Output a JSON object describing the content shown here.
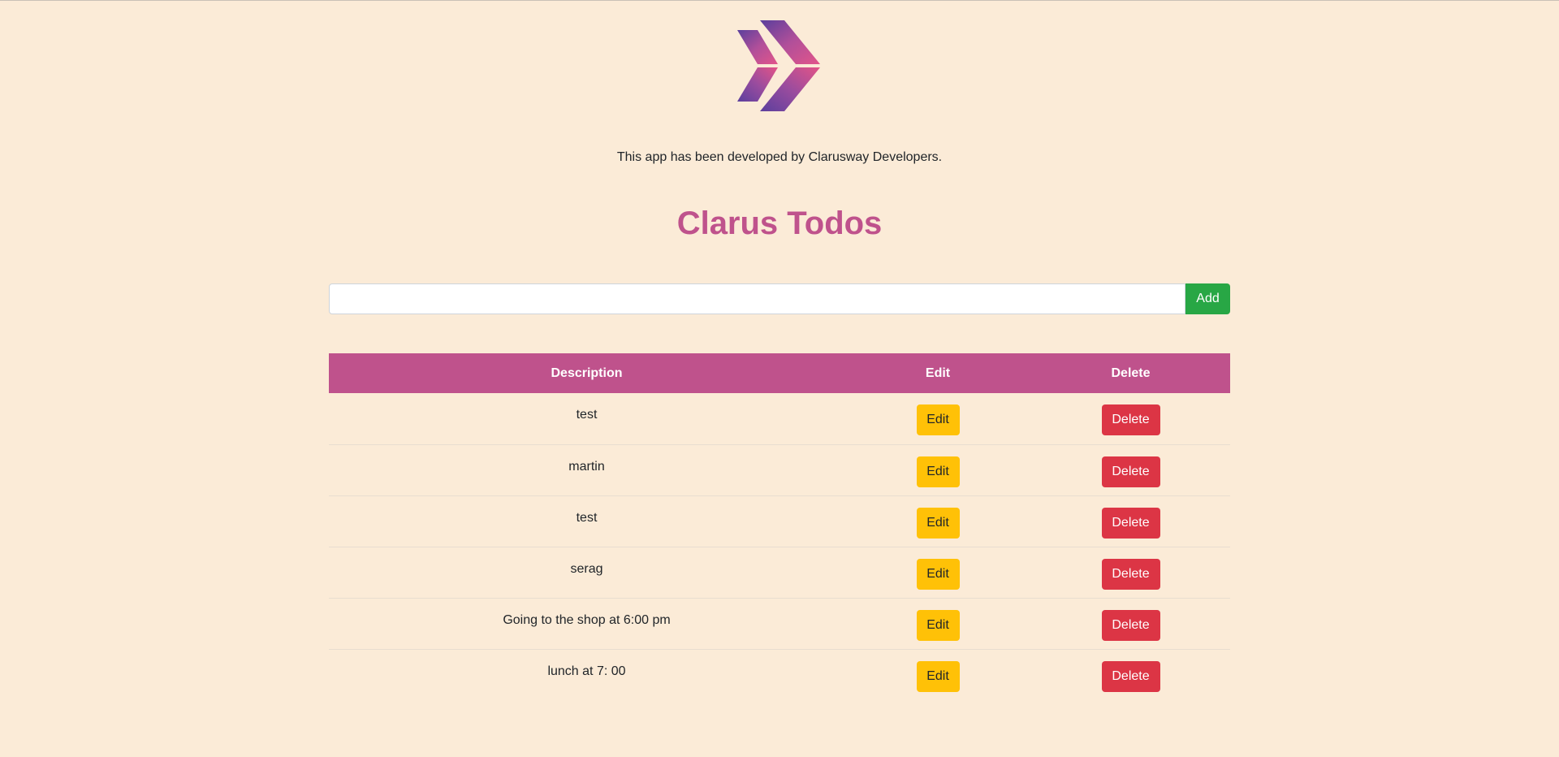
{
  "credit": "This app has been developed by Clarusway Developers.",
  "title": "Clarus Todos",
  "input": {
    "value": "",
    "placeholder": ""
  },
  "add_label": "Add",
  "table": {
    "headers": [
      "Description",
      "Edit",
      "Delete"
    ],
    "rows": [
      {
        "description": "test",
        "edit_label": "Edit",
        "delete_label": "Delete"
      },
      {
        "description": "martin",
        "edit_label": "Edit",
        "delete_label": "Delete"
      },
      {
        "description": "test",
        "edit_label": "Edit",
        "delete_label": "Delete"
      },
      {
        "description": "serag",
        "edit_label": "Edit",
        "delete_label": "Delete"
      },
      {
        "description": "Going to the shop at 6:00 pm",
        "edit_label": "Edit",
        "delete_label": "Delete"
      },
      {
        "description": "lunch at 7: 00",
        "edit_label": "Edit",
        "delete_label": "Delete"
      }
    ]
  },
  "colors": {
    "background": "#fbebd7",
    "accent": "#bf528c",
    "add": "#28a745",
    "edit": "#ffc107",
    "delete": "#dc3545"
  },
  "icons": {
    "logo": "clarusway-chevron-logo-icon"
  }
}
